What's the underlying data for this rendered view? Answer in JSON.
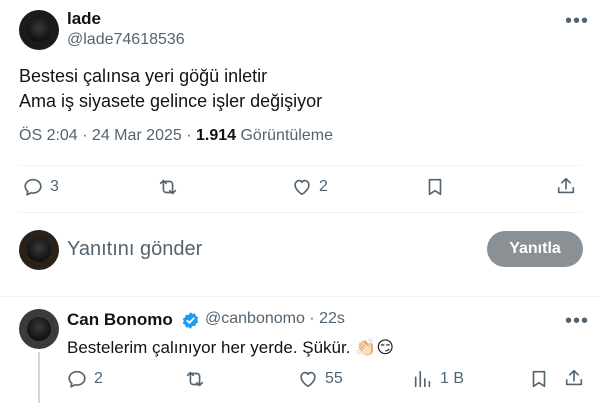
{
  "tweet": {
    "display_name": "lade",
    "handle": "@lade74618536",
    "line1": "Bestesi çalınsa yeri göğü inletir",
    "line2": "Ama iş siyasete gelince işler değişiyor",
    "time": "ÖS 2:04 · 24 Mar 2025 · ",
    "views_count": "1.914",
    "views_label": " Görüntüleme",
    "replies": "3",
    "retweets": "",
    "likes": "2"
  },
  "reply_box": {
    "placeholder": "Yanıtını gönder",
    "button": "Yanıtla"
  },
  "reply": {
    "display_name": "Can Bonomo",
    "handle": "@canbonomo · 22s",
    "text": "Bestelerim çalınıyor her yerde. Şükür. 👏🏻😏",
    "replies": "2",
    "retweets": "",
    "likes": "55",
    "views": "1 B"
  },
  "colors": {
    "verified": "#1d9bf0",
    "muted": "#536471",
    "button_disabled": "#8b9094"
  }
}
